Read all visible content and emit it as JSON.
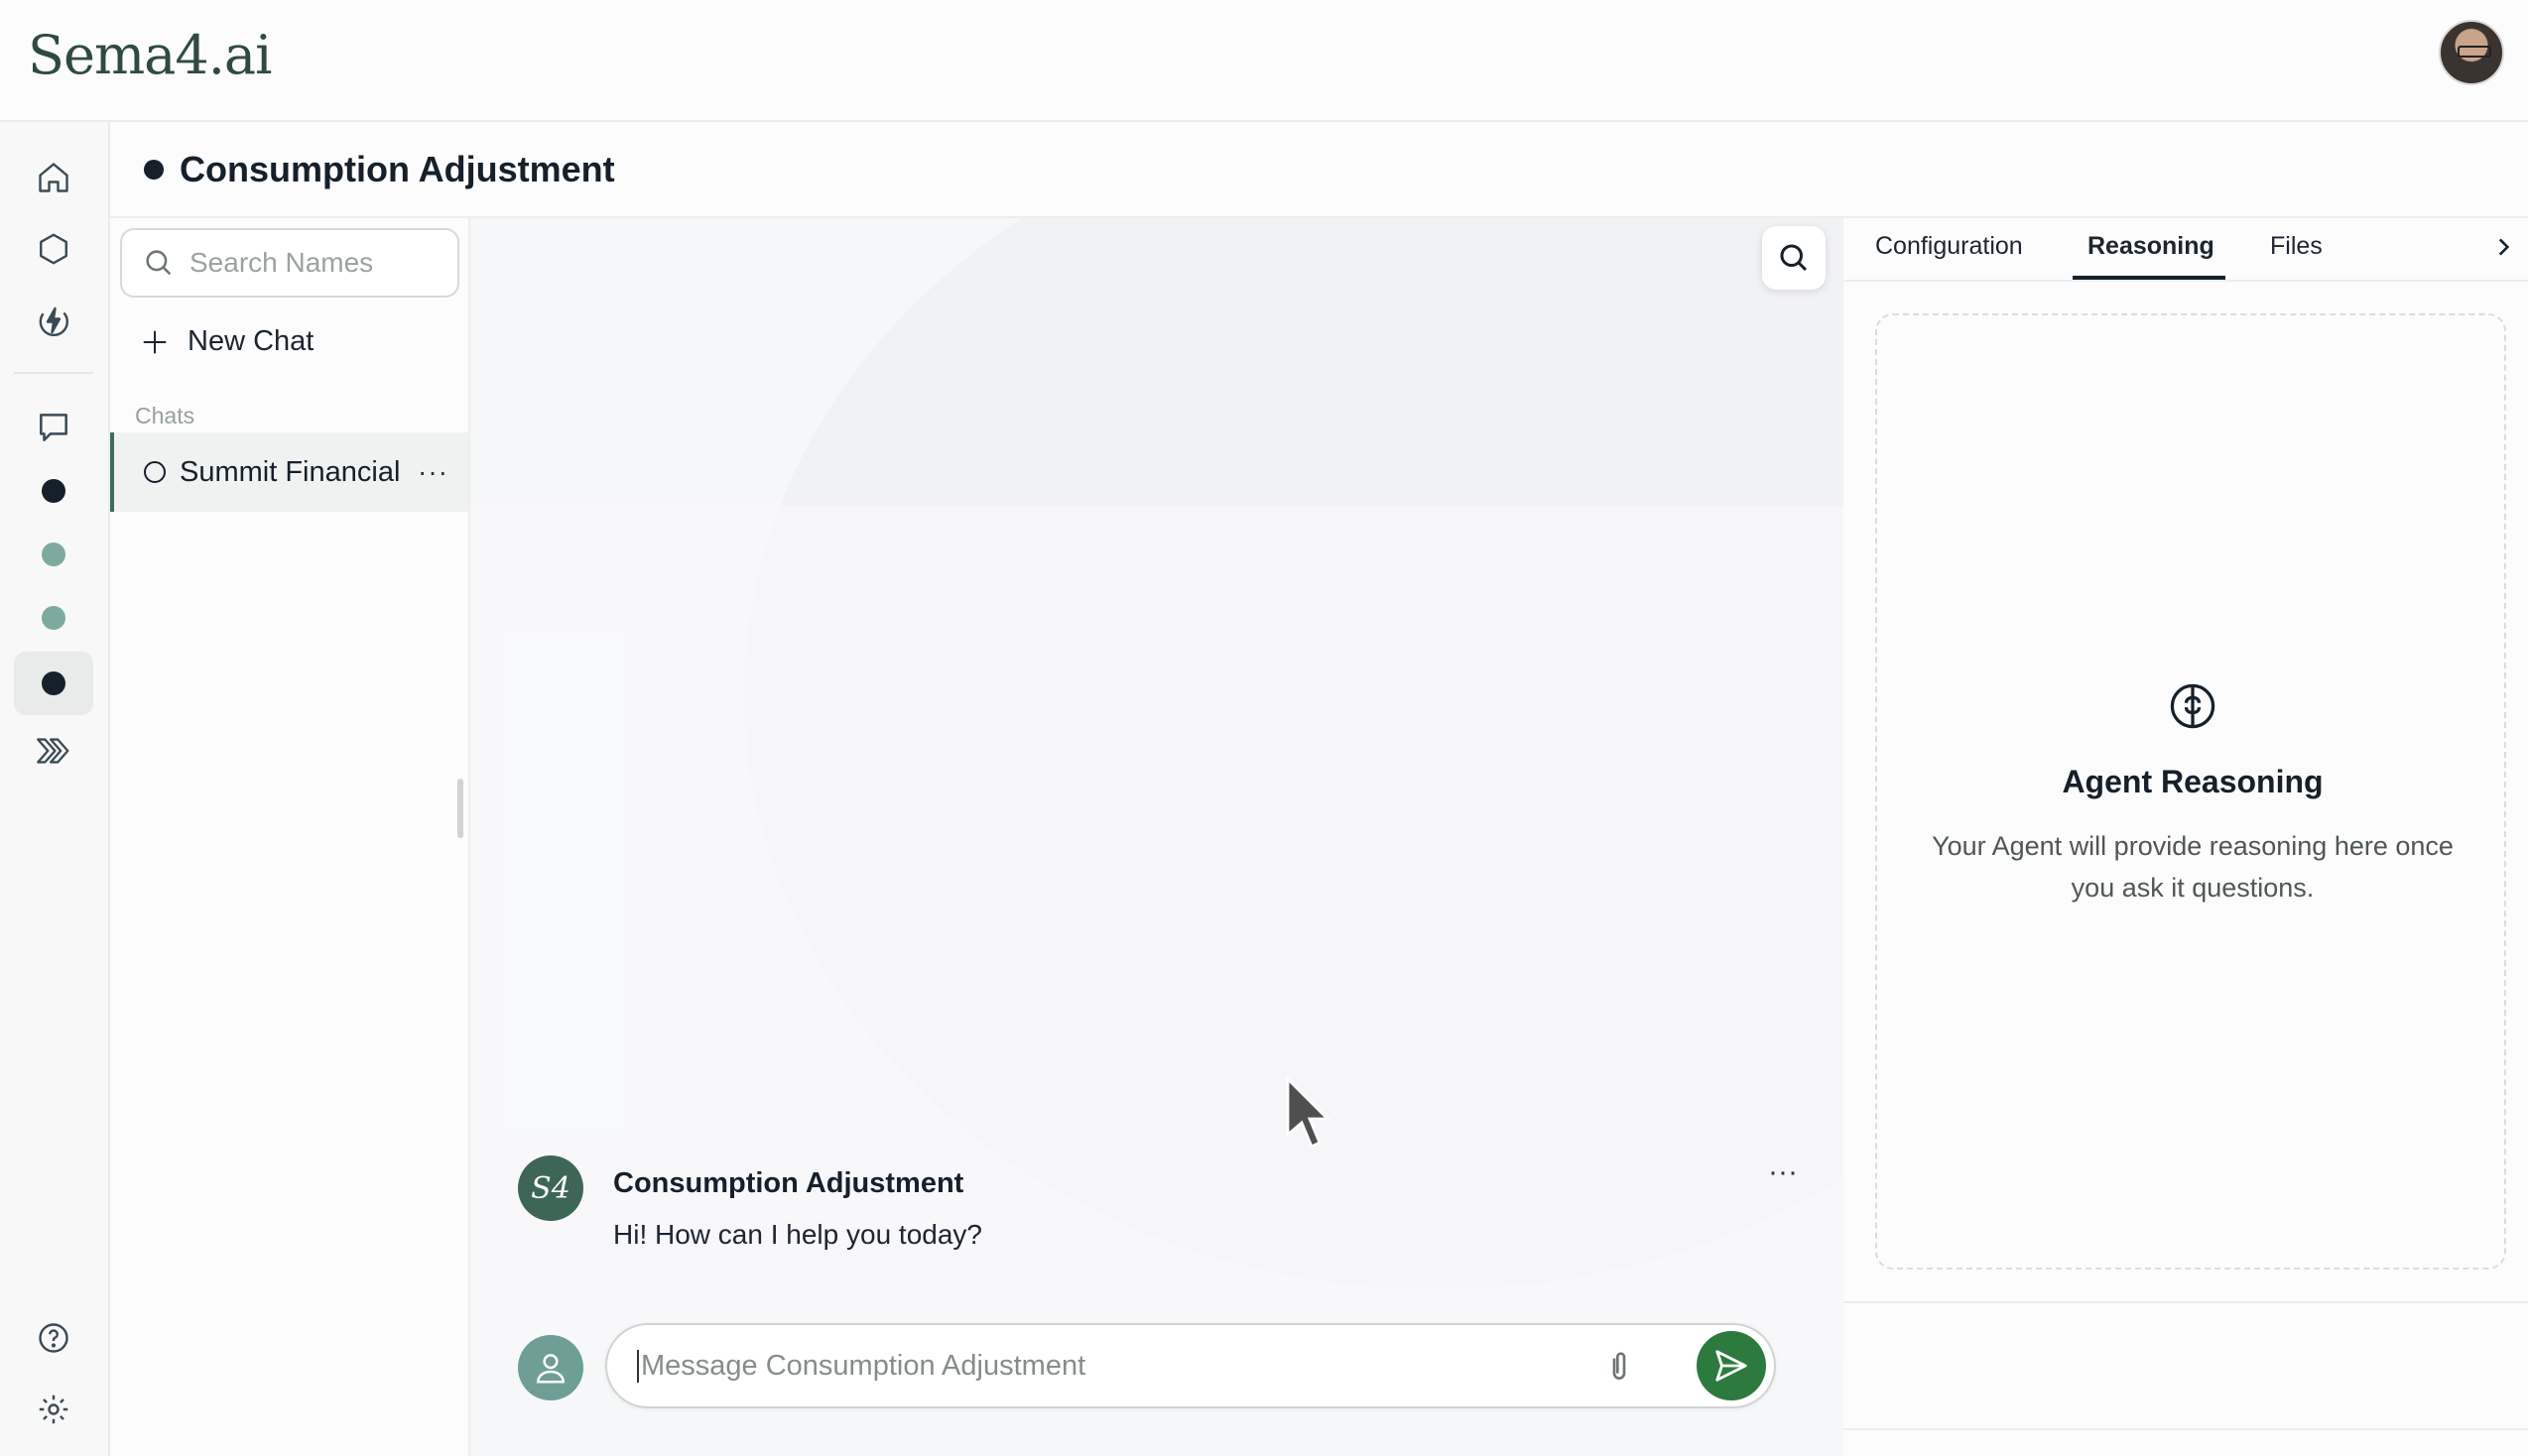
{
  "app": {
    "logo_text": "Sema4.ai",
    "accent_color": "#2c7a3e",
    "brand_color": "#3d6656"
  },
  "rail": {
    "icons": [
      "home-icon",
      "hexagon-icon",
      "lightning-icon",
      "chat-bubble-icon",
      "collapse-chevrons-icon",
      "help-icon",
      "settings-icon"
    ],
    "agent_dots": [
      "#15202b",
      "#7ea99f",
      "#7ea99f",
      "#15202b"
    ]
  },
  "header": {
    "title": "Consumption Adjustment"
  },
  "chatlist": {
    "search_placeholder": "Search Names",
    "new_chat_label": "New Chat",
    "section_label": "Chats",
    "items": [
      {
        "name": "Summit Financial",
        "more": "···"
      }
    ]
  },
  "main": {
    "message": {
      "avatar_text": "S4",
      "author": "Consumption Adjustment",
      "text": "Hi! How can I help you today?",
      "more": "···"
    },
    "composer": {
      "placeholder": "Message Consumption Adjustment"
    }
  },
  "rpanel": {
    "tabs": [
      "Configuration",
      "Reasoning",
      "Files"
    ],
    "active_tab": "Reasoning",
    "card_title": "Agent Reasoning",
    "card_text": "Your Agent will provide reasoning here once you ask it questions."
  }
}
